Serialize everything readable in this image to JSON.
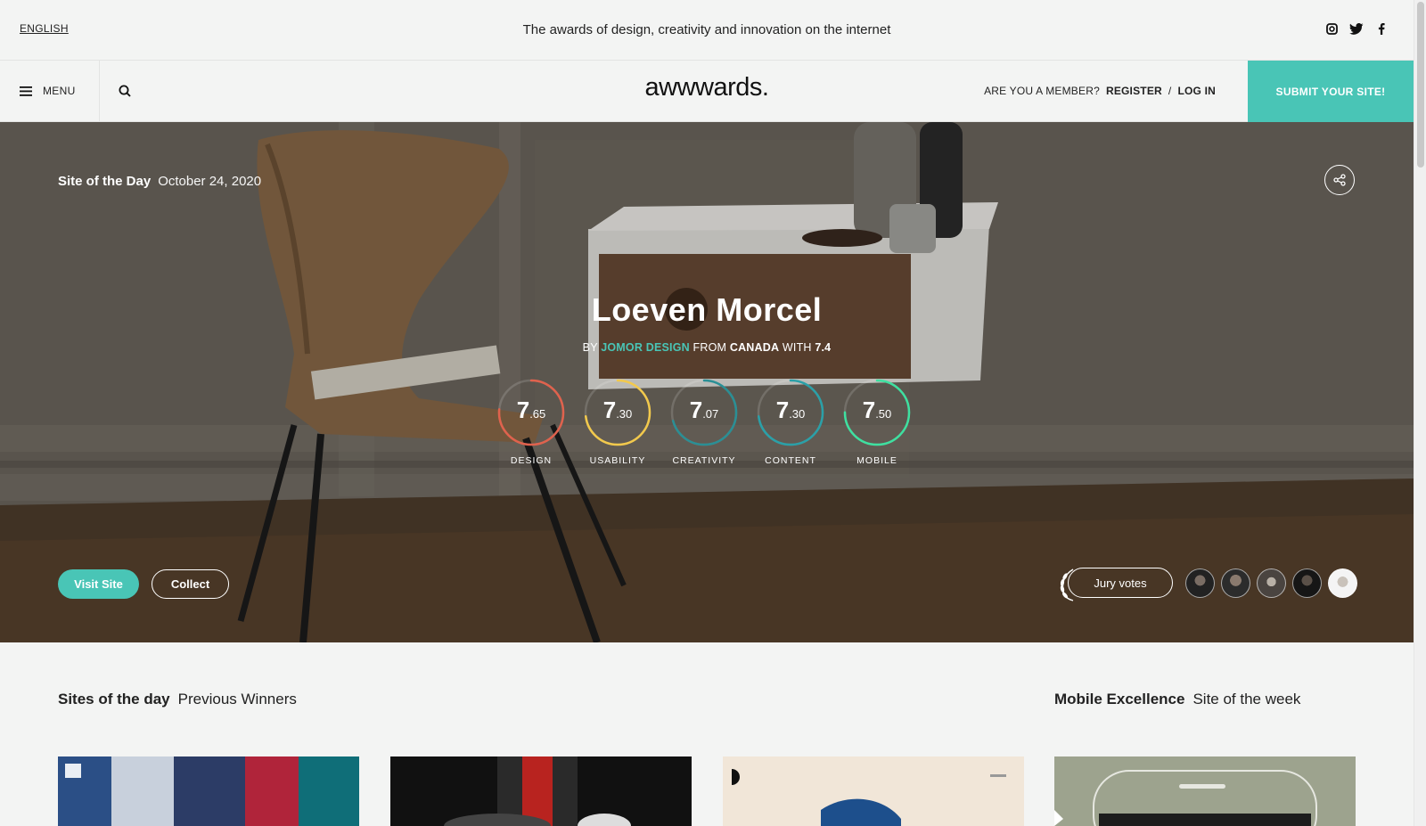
{
  "topbar": {
    "language": "ENGLISH",
    "tagline": "The awards of design, creativity and innovation on the internet",
    "social": [
      "instagram-icon",
      "twitter-icon",
      "facebook-icon"
    ]
  },
  "nav": {
    "menu_label": "MENU",
    "logo": "awwwards.",
    "member_question": "ARE YOU A MEMBER?",
    "register": "REGISTER",
    "separator": "/",
    "login": "LOG IN",
    "submit": "SUBMIT YOUR SITE!"
  },
  "hero": {
    "badge": "Site of the Day",
    "date": "October 24, 2020",
    "title": "Loeven Morcel",
    "by": "BY",
    "author": "JOMOR DESIGN",
    "from": "FROM",
    "country": "CANADA",
    "with": "WITH",
    "overall": "7.4",
    "scores": [
      {
        "whole": "7",
        "dec": ".65",
        "label": "DESIGN",
        "color": "#e0624d",
        "value": 7.65
      },
      {
        "whole": "7",
        "dec": ".30",
        "label": "USABILITY",
        "color": "#f2c94c",
        "value": 7.3
      },
      {
        "whole": "7",
        "dec": ".07",
        "label": "CREATIVITY",
        "color": "#2a8f95",
        "value": 7.07
      },
      {
        "whole": "7",
        "dec": ".30",
        "label": "CONTENT",
        "color": "#2aa0a8",
        "value": 7.3
      },
      {
        "whole": "7",
        "dec": ".50",
        "label": "MOBILE",
        "color": "#3ee0a0",
        "value": 7.5
      }
    ],
    "visit": "Visit Site",
    "collect": "Collect",
    "jury": "Jury votes",
    "jury_count": 5
  },
  "sections": {
    "sotd_title": "Sites of the day",
    "sotd_sub": "Previous Winners",
    "mobile_title": "Mobile Excellence",
    "mobile_sub": "Site of the week"
  },
  "colors": {
    "accent": "#49c5b6"
  }
}
